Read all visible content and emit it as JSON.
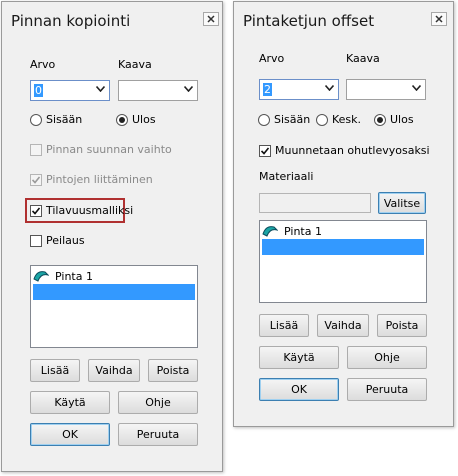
{
  "left": {
    "title": "Pinnan kopiointi",
    "labels": {
      "arvo": "Arvo",
      "kaava": "Kaava"
    },
    "arvo_value": "0",
    "kaava_value": "",
    "radios": [
      {
        "label": "Sisään",
        "checked": false
      },
      {
        "label": "Ulos",
        "checked": true
      }
    ],
    "checks": [
      {
        "label": "Pinnan suunnan vaihto",
        "checked": false,
        "enabled": false
      },
      {
        "label": "Pintojen liittäminen",
        "checked": true,
        "enabled": false
      },
      {
        "label": "Tilavuusmalliksi",
        "checked": true,
        "enabled": true
      },
      {
        "label": "Peilaus",
        "checked": false,
        "enabled": true
      }
    ],
    "list_items": [
      "Pinta 1"
    ],
    "buttons": {
      "add": "Lisää",
      "change": "Vaihda",
      "delete": "Poista",
      "apply": "Käytä",
      "help": "Ohje",
      "ok": "OK",
      "cancel": "Peruuta"
    }
  },
  "right": {
    "title": "Pintaketjun offset",
    "labels": {
      "arvo": "Arvo",
      "kaava": "Kaava",
      "material": "Materiaali"
    },
    "arvo_value": "2",
    "kaava_value": "",
    "radios": [
      {
        "label": "Sisään",
        "checked": false
      },
      {
        "label": "Kesk.",
        "checked": false
      },
      {
        "label": "Ulos",
        "checked": true
      }
    ],
    "checks": [
      {
        "label": "Muunnetaan ohutlevyosaksi",
        "checked": true,
        "enabled": true
      }
    ],
    "material_value": "",
    "select_button": "Valitse",
    "list_items": [
      "Pinta 1"
    ],
    "buttons": {
      "add": "Lisää",
      "change": "Vaihda",
      "delete": "Poista",
      "apply": "Käytä",
      "help": "Ohje",
      "ok": "OK",
      "cancel": "Peruuta"
    }
  },
  "icons": {
    "close": "close-icon",
    "dropdown": "chevron-down-icon",
    "surface": "surface-icon",
    "check": "checkmark-icon"
  },
  "colors": {
    "selection": "#3399ff",
    "highlight_frame": "#b03030",
    "dialog_bg": "#f0f0f0"
  }
}
